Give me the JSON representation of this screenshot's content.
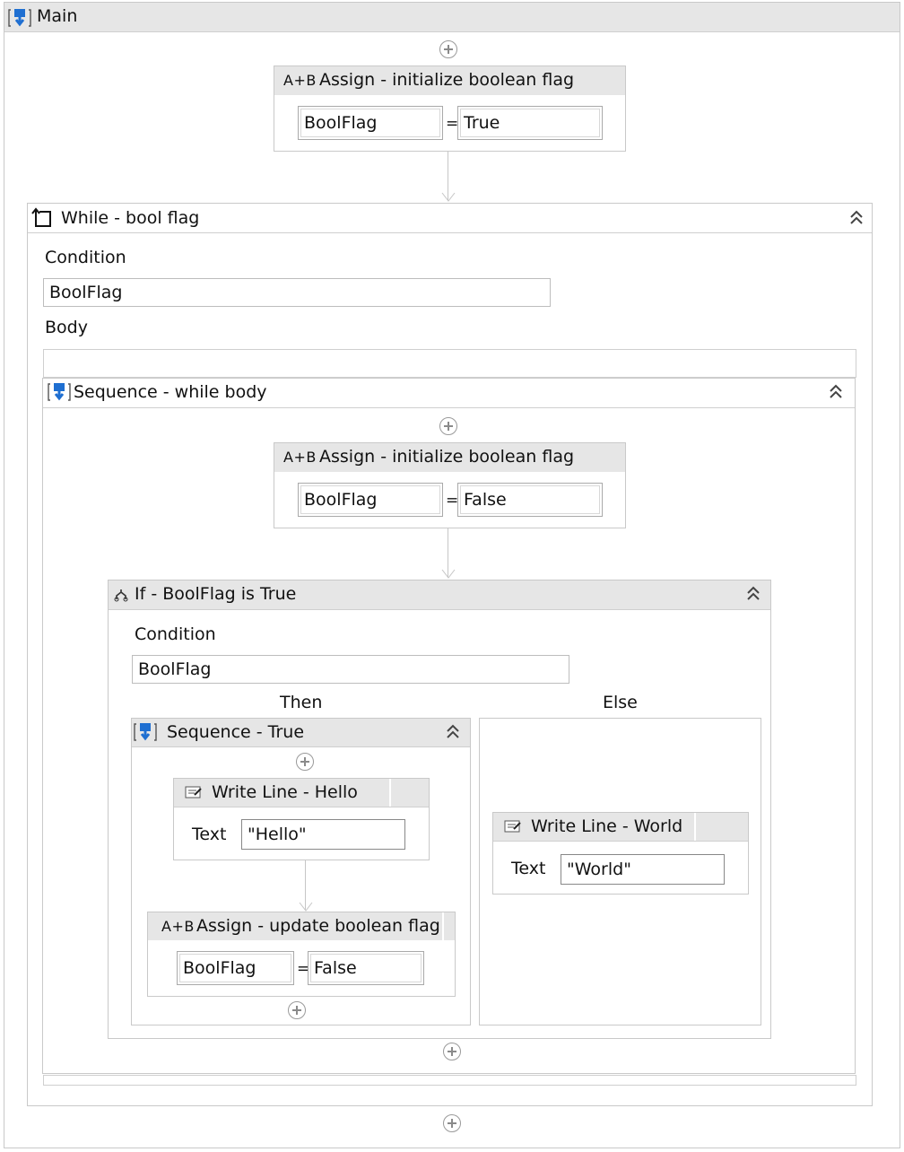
{
  "main": {
    "title": "Main"
  },
  "assign_init_true": {
    "title": "Assign - initialize boolean flag",
    "icon": "A+B",
    "target": "BoolFlag",
    "eq": "=",
    "value": "True"
  },
  "while": {
    "title": "While - bool flag",
    "condition_label": "Condition",
    "condition_value": "BoolFlag",
    "body_label": "Body"
  },
  "seq_while_body": {
    "title": "Sequence - while body"
  },
  "assign_init_false": {
    "title": "Assign - initialize boolean flag",
    "icon": "A+B",
    "target": "BoolFlag",
    "eq": "=",
    "value": "False"
  },
  "if_block": {
    "title": "If - BoolFlag is True",
    "condition_label": "Condition",
    "condition_value": "BoolFlag",
    "then_label": "Then",
    "else_label": "Else"
  },
  "seq_true": {
    "title": "Sequence - True"
  },
  "writeline_hello": {
    "title": "Write Line - Hello",
    "text_label": "Text",
    "text_value": "\"Hello\""
  },
  "assign_update": {
    "title": "Assign - update boolean flag",
    "icon": "A+B",
    "target": "BoolFlag",
    "eq": "=",
    "value": "False"
  },
  "writeline_world": {
    "title": "Write Line - World",
    "text_label": "Text",
    "text_value": "\"World\""
  },
  "colors": {
    "header_grey": "#e6e6e6",
    "border": "#c9c9c9",
    "icon_blue": "#1f6fd1"
  }
}
